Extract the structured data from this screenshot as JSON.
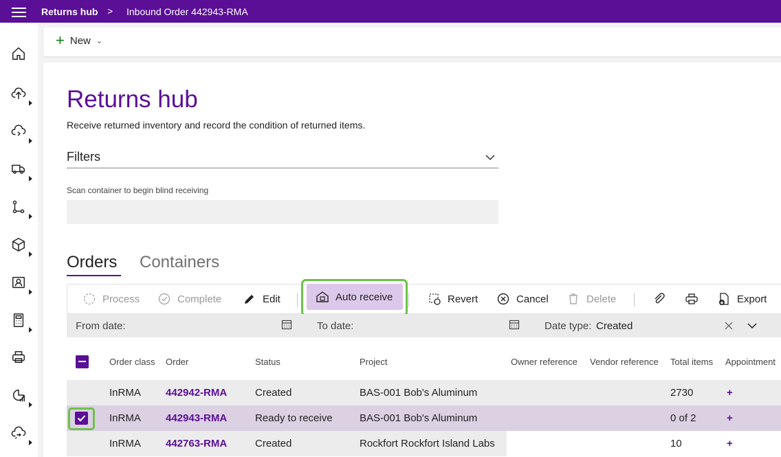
{
  "breadcrumb": {
    "app": "Returns hub",
    "separator": ">",
    "page": "Inbound Order 442943-RMA"
  },
  "rail": [
    "home-icon",
    "upload-icon",
    "refresh-cloud-icon",
    "truck-icon",
    "flow-icon",
    "box-icon",
    "contact-icon",
    "calculator-icon",
    "printer-icon",
    "report-icon",
    "cloud-sync-icon"
  ],
  "command": {
    "new_label": "New"
  },
  "page": {
    "title": "Returns hub",
    "subtitle": "Receive returned inventory and record the condition of returned items.",
    "filters_label": "Filters",
    "scan_label": "Scan container to begin blind receiving",
    "scan_placeholder": ""
  },
  "tabs": [
    {
      "label": "Orders"
    },
    {
      "label": "Containers"
    }
  ],
  "toolbar": {
    "process": "Process",
    "complete": "Complete",
    "edit": "Edit",
    "auto_receive": "Auto receive",
    "revert": "Revert",
    "cancel": "Cancel",
    "delete": "Delete",
    "export": "Export"
  },
  "datebar": {
    "from": "From date:",
    "to": "To date:",
    "type_label": "Date type:",
    "type_value": "Created"
  },
  "table": {
    "columns": [
      "Order class",
      "Order",
      "Status",
      "Project",
      "Owner reference",
      "Vendor reference",
      "Total items",
      "Appointment"
    ],
    "rows": [
      {
        "order_class": "InRMA",
        "order": "442942-RMA",
        "status": "Created",
        "project": "BAS-001 Bob's Aluminum",
        "total": "2730",
        "appointment": "+"
      },
      {
        "order_class": "InRMA",
        "order": "442943-RMA",
        "status": "Ready to receive",
        "project": "BAS-001 Bob's Aluminum",
        "total": "0 of 2",
        "appointment": "+"
      },
      {
        "order_class": "InRMA",
        "order": "442763-RMA",
        "status": "Created",
        "project": "Rockfort Rockfort Island Labs",
        "total": "10",
        "appointment": "+"
      }
    ]
  },
  "colors": {
    "brand": "#5a0f96",
    "highlight": "#6cc24a",
    "selected_row": "#dcd0e3"
  }
}
